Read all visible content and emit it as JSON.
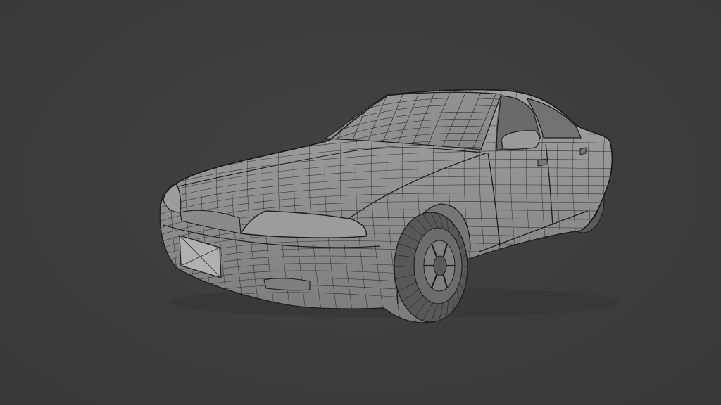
{
  "viewport": {
    "background_color": "#3d3d3d",
    "model_fill_color": "#8e8e8e",
    "wire_color": "#1e1e1e",
    "shading": "solid-with-wireframe-overlay",
    "subject": "car-model"
  }
}
